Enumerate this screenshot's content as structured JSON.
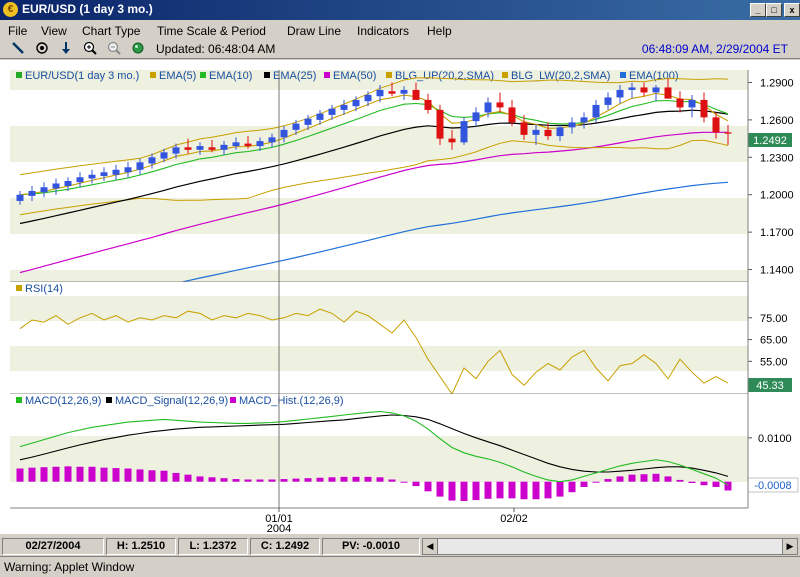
{
  "window": {
    "title": "EUR/USD (1 day  3 mo.)",
    "icon": "currency-icon",
    "min": "_",
    "max": "□",
    "close": "x"
  },
  "menu": [
    "File",
    "View",
    "Chart Type",
    "Time Scale & Period",
    "Draw Line",
    "Indicators",
    "Help"
  ],
  "toolbar": {
    "tools": [
      "draw-line-icon",
      "crosshair-icon",
      "down-arrow-icon",
      "zoom-in-icon",
      "zoom-out-icon",
      "refresh-icon"
    ],
    "updated": "Updated: 06:48:04 AM",
    "clock": "06:48:09 AM, 2/29/2004 ET"
  },
  "price_panel": {
    "legend": [
      "EUR/USD(1 day  3 mo.)",
      "EMA(5)",
      "EMA(10)",
      "EMA(25)",
      "EMA(50)",
      "BLG_UP(20,2,SMA)",
      "BLG_LW(20,2,SMA)",
      "EMA(100)"
    ],
    "legend_colors": [
      "#22aa22",
      "#c8a000",
      "#22bb22",
      "#000000",
      "#cc00cc",
      "#c8a000",
      "#c8a000",
      "#1e6fd8"
    ],
    "y_ticks": [
      "1.2900",
      "1.2600",
      "1.2300",
      "1.2000",
      "1.1700",
      "1.1400"
    ],
    "last_value": "1.2492"
  },
  "rsi_panel": {
    "legend": "RSI(14)",
    "y_ticks": [
      "75.00",
      "65.00",
      "55.00"
    ],
    "last_value": "45.33"
  },
  "macd_panel": {
    "legend": [
      "MACD(12,26,9)",
      "MACD_Signal(12,26,9)",
      "MACD_Hist.(12,26,9)"
    ],
    "y_ticks": [
      "0.0100"
    ],
    "last_value": "-0.0008"
  },
  "x_axis": {
    "labels": [
      "01/01",
      "2004",
      "02/02"
    ]
  },
  "status": {
    "date": "02/27/2004",
    "high": "H: 1.2510",
    "low": "L: 1.2372",
    "close": "C: 1.2492",
    "pv": "PV: -0.0010"
  },
  "warning": "Warning: Applet Window",
  "chart_data": [
    {
      "type": "candlestick",
      "title": "EUR/USD(1 day  3 mo.)",
      "ylim": [
        1.13,
        1.3
      ],
      "ohlc": [
        [
          1.195,
          1.203,
          1.192,
          1.2
        ],
        [
          1.199,
          1.207,
          1.195,
          1.203
        ],
        [
          1.202,
          1.21,
          1.198,
          1.206
        ],
        [
          1.205,
          1.213,
          1.2,
          1.209
        ],
        [
          1.207,
          1.214,
          1.203,
          1.211
        ],
        [
          1.21,
          1.218,
          1.206,
          1.214
        ],
        [
          1.213,
          1.22,
          1.209,
          1.216
        ],
        [
          1.215,
          1.222,
          1.211,
          1.218
        ],
        [
          1.216,
          1.224,
          1.212,
          1.22
        ],
        [
          1.218,
          1.226,
          1.214,
          1.222
        ],
        [
          1.22,
          1.229,
          1.216,
          1.226
        ],
        [
          1.225,
          1.233,
          1.221,
          1.23
        ],
        [
          1.229,
          1.237,
          1.226,
          1.234
        ],
        [
          1.233,
          1.241,
          1.229,
          1.238
        ],
        [
          1.238,
          1.245,
          1.233,
          1.236
        ],
        [
          1.236,
          1.242,
          1.232,
          1.239
        ],
        [
          1.238,
          1.244,
          1.234,
          1.236
        ],
        [
          1.236,
          1.243,
          1.232,
          1.24
        ],
        [
          1.239,
          1.246,
          1.236,
          1.242
        ],
        [
          1.241,
          1.247,
          1.237,
          1.239
        ],
        [
          1.239,
          1.246,
          1.235,
          1.243
        ],
        [
          1.242,
          1.249,
          1.238,
          1.246
        ],
        [
          1.246,
          1.255,
          1.242,
          1.252
        ],
        [
          1.252,
          1.26,
          1.248,
          1.257
        ],
        [
          1.256,
          1.264,
          1.252,
          1.261
        ],
        [
          1.26,
          1.268,
          1.256,
          1.265
        ],
        [
          1.264,
          1.272,
          1.26,
          1.269
        ],
        [
          1.268,
          1.276,
          1.264,
          1.272
        ],
        [
          1.271,
          1.279,
          1.267,
          1.276
        ],
        [
          1.275,
          1.283,
          1.271,
          1.28
        ],
        [
          1.279,
          1.288,
          1.274,
          1.284
        ],
        [
          1.283,
          1.29,
          1.279,
          1.281
        ],
        [
          1.281,
          1.287,
          1.276,
          1.284
        ],
        [
          1.284,
          1.29,
          1.277,
          1.276
        ],
        [
          1.276,
          1.281,
          1.265,
          1.268
        ],
        [
          1.268,
          1.272,
          1.24,
          1.245
        ],
        [
          1.245,
          1.252,
          1.236,
          1.242
        ],
        [
          1.242,
          1.262,
          1.24,
          1.259
        ],
        [
          1.259,
          1.27,
          1.255,
          1.266
        ],
        [
          1.266,
          1.278,
          1.262,
          1.274
        ],
        [
          1.274,
          1.282,
          1.266,
          1.27
        ],
        [
          1.27,
          1.276,
          1.255,
          1.258
        ],
        [
          1.258,
          1.264,
          1.244,
          1.248
        ],
        [
          1.248,
          1.256,
          1.24,
          1.252
        ],
        [
          1.252,
          1.258,
          1.244,
          1.247
        ],
        [
          1.247,
          1.256,
          1.243,
          1.254
        ],
        [
          1.254,
          1.262,
          1.249,
          1.258
        ],
        [
          1.258,
          1.266,
          1.253,
          1.262
        ],
        [
          1.262,
          1.276,
          1.258,
          1.272
        ],
        [
          1.272,
          1.282,
          1.268,
          1.278
        ],
        [
          1.278,
          1.288,
          1.273,
          1.284
        ],
        [
          1.284,
          1.29,
          1.277,
          1.286
        ],
        [
          1.286,
          1.29,
          1.279,
          1.282
        ],
        [
          1.282,
          1.288,
          1.275,
          1.286
        ],
        [
          1.286,
          1.293,
          1.28,
          1.277
        ],
        [
          1.277,
          1.283,
          1.266,
          1.27
        ],
        [
          1.27,
          1.28,
          1.262,
          1.276
        ],
        [
          1.276,
          1.282,
          1.258,
          1.262
        ],
        [
          1.262,
          1.266,
          1.245,
          1.25
        ],
        [
          1.25,
          1.256,
          1.24,
          1.249
        ]
      ]
    },
    {
      "type": "line",
      "title": "RSI(14)",
      "ylim": [
        40,
        85
      ],
      "values": [
        70,
        74,
        73,
        76,
        72,
        75,
        77,
        74,
        76,
        73,
        75,
        74,
        76,
        75,
        78,
        77,
        74,
        76,
        75,
        77,
        76,
        74,
        75,
        77,
        76,
        79,
        77,
        73,
        78,
        76,
        72,
        68,
        74,
        66,
        56,
        48,
        40,
        52,
        47,
        55,
        60,
        49,
        44,
        50,
        54,
        51,
        57,
        60,
        52,
        46,
        53,
        54,
        58,
        54,
        47,
        56,
        50,
        45,
        48,
        45
      ]
    },
    {
      "type": "line",
      "title": "MACD(12,26,9)",
      "ylim": [
        -0.006,
        0.02
      ],
      "series": [
        {
          "name": "MACD(12,26,9)",
          "values": [
            0.008,
            0.0088,
            0.0096,
            0.0104,
            0.0112,
            0.0118,
            0.0124,
            0.0128,
            0.0132,
            0.0136,
            0.0138,
            0.014,
            0.0142,
            0.014,
            0.0138,
            0.0136,
            0.0135,
            0.0134,
            0.0133,
            0.0133,
            0.0134,
            0.0135,
            0.0137,
            0.014,
            0.0143,
            0.0146,
            0.0149,
            0.0152,
            0.0155,
            0.0158,
            0.016,
            0.0157,
            0.015,
            0.0138,
            0.012,
            0.0098,
            0.0078,
            0.0066,
            0.0058,
            0.0052,
            0.0044,
            0.0034,
            0.0022,
            0.0012,
            0.0004,
            0.0,
            0.0004,
            0.0012,
            0.002,
            0.0028,
            0.0036,
            0.0042,
            0.0046,
            0.005,
            0.0046,
            0.0038,
            0.0028,
            0.0018,
            0.0008,
            -0.0008
          ]
        },
        {
          "name": "MACD_Signal(12,26,9)",
          "values": [
            0.005,
            0.0056,
            0.0063,
            0.007,
            0.0077,
            0.0084,
            0.009,
            0.0096,
            0.0101,
            0.0106,
            0.011,
            0.0114,
            0.0117,
            0.012,
            0.0122,
            0.0124,
            0.0125,
            0.0126,
            0.0127,
            0.0128,
            0.0129,
            0.013,
            0.0131,
            0.0133,
            0.0135,
            0.0137,
            0.0139,
            0.0141,
            0.0144,
            0.0147,
            0.015,
            0.0152,
            0.0151,
            0.0148,
            0.0142,
            0.0132,
            0.0121,
            0.011,
            0.01,
            0.0091,
            0.0082,
            0.0072,
            0.0062,
            0.0052,
            0.0042,
            0.0034,
            0.0028,
            0.0024,
            0.0022,
            0.0022,
            0.0024,
            0.0026,
            0.0029,
            0.0032,
            0.0034,
            0.0034,
            0.0031,
            0.0026,
            0.002,
            0.0012
          ]
        },
        {
          "name": "MACD_Hist.(12,26,9)",
          "values": [
            0.003,
            0.0032,
            0.0033,
            0.0034,
            0.0035,
            0.0034,
            0.0034,
            0.0032,
            0.0031,
            0.003,
            0.0028,
            0.0026,
            0.0025,
            0.002,
            0.0016,
            0.0012,
            0.001,
            0.0008,
            0.0006,
            0.0005,
            0.0005,
            0.0005,
            0.0006,
            0.0007,
            0.0008,
            0.0009,
            0.001,
            0.0011,
            0.0011,
            0.0011,
            0.001,
            0.0005,
            -0.0001,
            -0.001,
            -0.0022,
            -0.0034,
            -0.0043,
            -0.0044,
            -0.0042,
            -0.0039,
            -0.0038,
            -0.0038,
            -0.004,
            -0.004,
            -0.0038,
            -0.0034,
            -0.0024,
            -0.0012,
            -0.0002,
            0.0006,
            0.0012,
            0.0016,
            0.0017,
            0.0018,
            0.0012,
            0.0004,
            -0.0003,
            -0.0008,
            -0.0012,
            -0.002
          ]
        }
      ]
    }
  ]
}
